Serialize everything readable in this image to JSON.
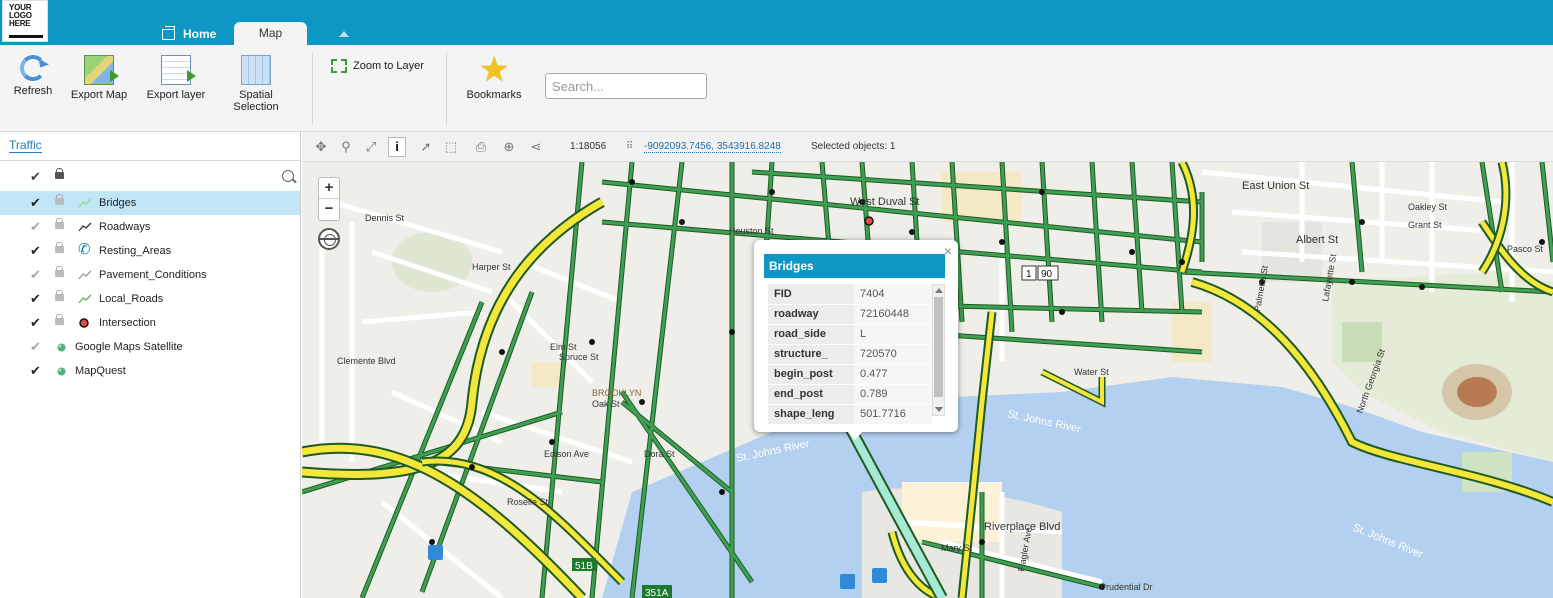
{
  "logo": {
    "text": "YOUR LOGO HERE"
  },
  "tabs": [
    {
      "label": "Home"
    },
    {
      "label": "Map"
    }
  ],
  "ribbon": {
    "refresh": "Refresh",
    "export_map": "Export Map",
    "export_layer": "Export layer",
    "spatial_selection": "Spatial Selection",
    "zoom_to_layer": "Zoom to Layer",
    "bookmarks": "Bookmarks",
    "search_placeholder": "Search..."
  },
  "panel": {
    "tab": "Traffic",
    "layers": [
      {
        "name": "Bridges",
        "checked": true,
        "selected": true,
        "symbol": "line-light"
      },
      {
        "name": "Roadways",
        "checked": false,
        "selected": false,
        "symbol": "line-dark"
      },
      {
        "name": "Resting_Areas",
        "checked": true,
        "selected": false,
        "symbol": "phone"
      },
      {
        "name": "Pavement_Conditions",
        "checked": false,
        "selected": false,
        "symbol": "line-gray"
      },
      {
        "name": "Local_Roads",
        "checked": true,
        "selected": false,
        "symbol": "line-green"
      },
      {
        "name": "Intersection",
        "checked": true,
        "selected": false,
        "symbol": "dot-red"
      },
      {
        "name": "Google Maps Satellite",
        "checked": false,
        "selected": false,
        "symbol": "globe"
      },
      {
        "name": "MapQuest",
        "checked": true,
        "selected": false,
        "symbol": "globe"
      }
    ]
  },
  "map_toolbar": {
    "scale": "1:18056",
    "coordinates": "-9092093.7456, 3543916.8248",
    "selected_objects": "Selected objects: 1"
  },
  "popup": {
    "title": "Bridges",
    "rows": [
      {
        "key": "FID",
        "value": "7404"
      },
      {
        "key": "roadway",
        "value": "72160448"
      },
      {
        "key": "road_side",
        "value": "L"
      },
      {
        "key": "structure_",
        "value": "720570"
      },
      {
        "key": "begin_post",
        "value": "0.477"
      },
      {
        "key": "end_post",
        "value": "0.789"
      },
      {
        "key": "shape_leng",
        "value": "501.7716"
      }
    ]
  },
  "map_labels": {
    "east_union": "East Union St",
    "albert": "Albert St",
    "oakley": "Oakley St",
    "grant": "Grant St",
    "pasco": "Pasco St",
    "west_duval": "West Duval St",
    "houston": "Houston St",
    "dennis": "Dennis St",
    "harper": "Harper St",
    "clemente": "Clemente Blvd",
    "elm": "Elm St",
    "spruce": "Spruce St",
    "chelsea": "Chelsea St",
    "oak": "Oak St",
    "brooklyn": "BROOKLYN",
    "edison": "Edison Ave",
    "dora": "Dora St",
    "roselle": "Roselle St",
    "st_johns_1": "St. Johns River",
    "st_johns_2": "St. Johns River",
    "st_johns_3": "St. Johns River",
    "water": "Water St",
    "riverplace": "Riverplace Blvd",
    "prudential": "Prudential Dr",
    "mary": "Mary St",
    "flagler": "Flagler Ave",
    "palmetto": "Palmetto St",
    "lafayette": "Lafayette St",
    "north_georgia": "North Georgia St",
    "exit_351a": "351A",
    "exit_51b": "51B",
    "shield_1": "1",
    "shield_90": "90"
  },
  "colors": {
    "topbar": "#0c97c5",
    "road_green": "#2e8b3a",
    "road_yellow": "#f5e63a",
    "water": "#b4d0f0"
  }
}
